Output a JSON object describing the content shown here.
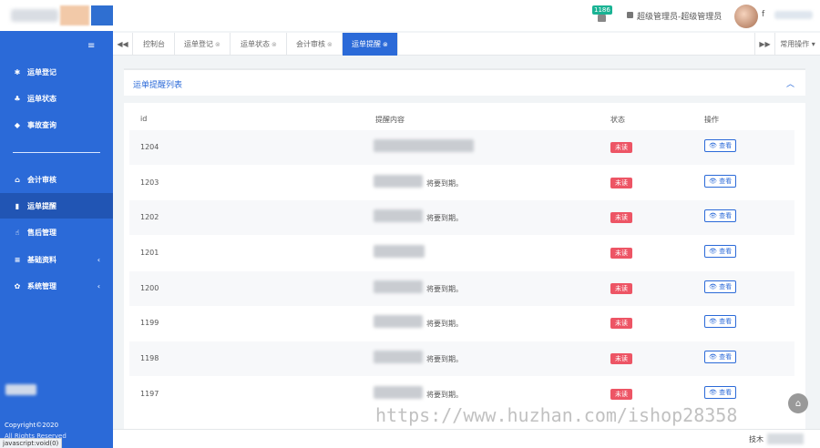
{
  "header": {
    "notification_count": "1186",
    "user_role": "超级管理员-超级管理员",
    "user_initial": "f"
  },
  "sidebar": {
    "toggle_icon": "menu-icon",
    "items": [
      {
        "label": "运单登记",
        "icon": "paw-icon"
      },
      {
        "label": "运单状态",
        "icon": "sitemap-icon"
      },
      {
        "label": "事故查询",
        "icon": "diamond-icon"
      },
      {
        "label": "会计审核",
        "icon": "bank-icon"
      },
      {
        "label": "运单提醒",
        "icon": "bar-chart-icon"
      },
      {
        "label": "售后管理",
        "icon": "thumbs-up-icon"
      },
      {
        "label": "基础资料",
        "icon": "list-icon"
      },
      {
        "label": "系统管理",
        "icon": "gear-icon"
      }
    ],
    "copyright": "Copyright©2020",
    "copyright_line2": "All Rights Reserved"
  },
  "status_bar": "javascript:void(0)",
  "tabs": [
    {
      "label": "控制台"
    },
    {
      "label": "运单登记"
    },
    {
      "label": "运单状态"
    },
    {
      "label": "会计审核"
    },
    {
      "label": "运单提醒"
    }
  ],
  "tab_ops_label": "常用操作",
  "panel": {
    "title": "运单提醒列表"
  },
  "table": {
    "headers": [
      "id",
      "提醒内容",
      "状态",
      "操作"
    ],
    "rows": [
      {
        "id": "1204",
        "msg": "",
        "status": "未读",
        "action": "查看"
      },
      {
        "id": "1203",
        "msg": "将要到期。",
        "status": "未读",
        "action": "查看"
      },
      {
        "id": "1202",
        "msg": "将要到期。",
        "status": "未读",
        "action": "查看"
      },
      {
        "id": "1201",
        "msg": "",
        "status": "未读",
        "action": "查看"
      },
      {
        "id": "1200",
        "msg": "将要到期。",
        "status": "未读",
        "action": "查看"
      },
      {
        "id": "1199",
        "msg": "将要到期。",
        "status": "未读",
        "action": "查看"
      },
      {
        "id": "1198",
        "msg": "将要到期。",
        "status": "未读",
        "action": "查看"
      },
      {
        "id": "1197",
        "msg": "将要到期。",
        "status": "未读",
        "action": "查看"
      }
    ]
  },
  "footer": {
    "tech_label": "技木"
  },
  "watermark": "https://www.huzhan.com/ishop28358",
  "colors": {
    "primary": "#2b6ad8",
    "unread_badge": "#ed5565",
    "notify_badge": "#1ab394"
  }
}
